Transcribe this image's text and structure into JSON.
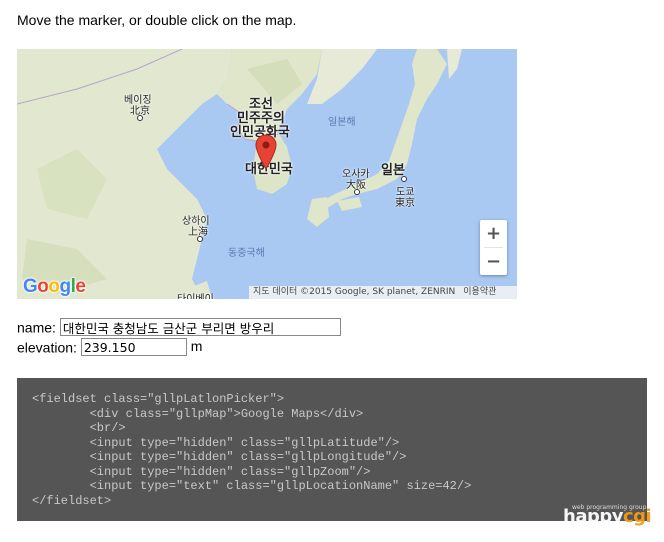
{
  "instruction": "Move the marker, or double click on the map.",
  "map": {
    "labels": {
      "beijing": [
        "베이징",
        "北京"
      ],
      "dprk": [
        "조선",
        "민주주의",
        "인민공화국"
      ],
      "sea_of_japan": "일본해",
      "korea": "대한민국",
      "osaka": [
        "오사카",
        "大阪"
      ],
      "japan": "일본",
      "tokyo": [
        "도쿄",
        "東京"
      ],
      "shanghai": [
        "상하이",
        "上海"
      ],
      "east_china_sea": "동중국해",
      "taipei": "타이베이"
    },
    "zoom_in_label": "+",
    "zoom_out_label": "−",
    "logo": "Google",
    "attribution": "지도 데이터 ©2015 Google, SK planet, ZENRIN",
    "terms": "이용약관",
    "marker_icon": "map-pin-icon"
  },
  "form": {
    "name_label": "name:",
    "name_value": "대한민국 충청남도 금산군 부리면 방우리",
    "elevation_label": "elevation:",
    "elevation_value": "239.150",
    "elevation_unit": "m"
  },
  "code": {
    "lines": [
      "<fieldset class=\"gllpLatlonPicker\">",
      "        <div class=\"gllpMap\">Google Maps</div>",
      "        <br/>",
      "        <input type=\"hidden\" class=\"gllpLatitude\"/>",
      "        <input type=\"hidden\" class=\"gllpLongitude\"/>",
      "        <input type=\"hidden\" class=\"gllpZoom\"/>",
      "        <input type=\"text\" class=\"gllpLocationName\" size=42/>",
      "</fieldset>"
    ]
  },
  "watermark": {
    "sub": "web programming group",
    "brand_a": "happy",
    "brand_b": "cgi"
  },
  "colors": {
    "water": "#a8c8f0",
    "land": "#e3e8d2",
    "marker": "#e84235",
    "code_bg": "#555555"
  }
}
